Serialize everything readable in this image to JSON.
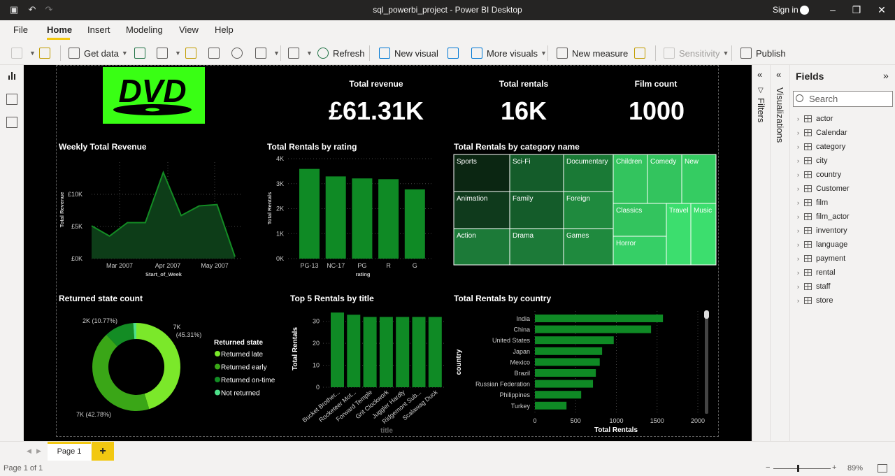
{
  "window": {
    "title": "sql_powerbi_project - Power BI Desktop",
    "signin": "Sign in"
  },
  "menu": [
    "File",
    "Home",
    "Insert",
    "Modeling",
    "View",
    "Help"
  ],
  "ribbon": {
    "get_data": "Get data",
    "refresh": "Refresh",
    "new_visual": "New visual",
    "more_visuals": "More visuals",
    "new_measure": "New measure",
    "sensitivity": "Sensitivity",
    "publish": "Publish"
  },
  "logo": {
    "text": "DVD",
    "color": "#39ff14"
  },
  "kpis": [
    {
      "label": "Total revenue",
      "value": "£61.31K"
    },
    {
      "label": "Total rentals",
      "value": "16K"
    },
    {
      "label": "Film count",
      "value": "1000"
    }
  ],
  "colors": {
    "accent": "#f2c811",
    "bar": "#0f8a25",
    "dark_green": "#0b3d1a"
  },
  "chart_data": [
    {
      "type": "area",
      "title": "Weekly Total Revenue",
      "xlabel": "Start_of_Week",
      "ylabel": "Total Revenue",
      "x_ticks": [
        "Mar 2007",
        "Apr 2007",
        "May 2007"
      ],
      "y_ticks": [
        "£0K",
        "£5K",
        "£10K"
      ],
      "ylim": [
        0,
        15000
      ],
      "values": [
        5100,
        3500,
        5600,
        5600,
        13400,
        6700,
        8200,
        8400,
        300
      ]
    },
    {
      "type": "bar",
      "title": "Total Rentals by rating",
      "xlabel": "rating",
      "ylabel": "Total Rentals",
      "categories": [
        "PG-13",
        "NC-17",
        "PG",
        "R",
        "G"
      ],
      "values": [
        3590,
        3290,
        3210,
        3180,
        2770
      ],
      "y_ticks": [
        "0K",
        "1K",
        "2K",
        "3K",
        "4K"
      ],
      "ylim": [
        0,
        4000
      ]
    },
    {
      "type": "treemap",
      "title": "Total Rentals by category name",
      "categories": [
        "Sports",
        "Sci-Fi",
        "Documentary",
        "Children",
        "Comedy",
        "New",
        "Animation",
        "Family",
        "Foreign",
        "Classics",
        "Travel",
        "Music",
        "Action",
        "Drama",
        "Games",
        "Horror"
      ]
    },
    {
      "type": "pie",
      "title": "Returned state count",
      "legend_title": "Returned state",
      "slices": [
        {
          "label": "Returned late",
          "value": 45.31,
          "text": "7K (45.31%)",
          "color": "#7be82a"
        },
        {
          "label": "Returned early",
          "value": 42.78,
          "text": "7K (42.78%)",
          "color": "#3aa617"
        },
        {
          "label": "Returned on-time",
          "value": 10.77,
          "text": "2K (10.77%)",
          "color": "#138c24"
        },
        {
          "label": "Not returned",
          "value": 1.14,
          "text": "",
          "color": "#4de08a"
        }
      ]
    },
    {
      "type": "bar",
      "title": "Top 5 Rentals by title",
      "xlabel": "title",
      "ylabel": "Total Rentals",
      "categories": [
        "Bucket Brother...",
        "Rocketeer Mot...",
        "Forward Temple",
        "Grit Clockwork",
        "Juggler Hardly",
        "Ridgemont Sub...",
        "Scalawag Duck"
      ],
      "values": [
        34,
        33,
        32,
        32,
        32,
        32,
        32
      ],
      "y_ticks": [
        "0",
        "10",
        "20",
        "30"
      ],
      "ylim": [
        0,
        35
      ]
    },
    {
      "type": "bar",
      "orientation": "horizontal",
      "title": "Total Rentals by country",
      "xlabel": "Total Rentals",
      "ylabel": "country",
      "categories": [
        "India",
        "China",
        "United States",
        "Japan",
        "Mexico",
        "Brazil",
        "Russian Federation",
        "Philippines",
        "Turkey"
      ],
      "values": [
        1572,
        1426,
        968,
        825,
        796,
        748,
        713,
        568,
        388
      ],
      "x_ticks": [
        "0",
        "500",
        "1000",
        "1500",
        "2000"
      ],
      "xlim": [
        0,
        2000
      ]
    }
  ],
  "panes": {
    "filters": "Filters",
    "visualizations": "Visualizations",
    "fields_title": "Fields",
    "search_placeholder": "Search"
  },
  "fields": [
    "actor",
    "Calendar",
    "category",
    "city",
    "country",
    "Customer",
    "film",
    "film_actor",
    "inventory",
    "language",
    "payment",
    "rental",
    "staff",
    "store"
  ],
  "pages": {
    "tab": "Page 1",
    "add": "+"
  },
  "status": {
    "page_info": "Page 1 of 1",
    "zoom": "89%"
  }
}
